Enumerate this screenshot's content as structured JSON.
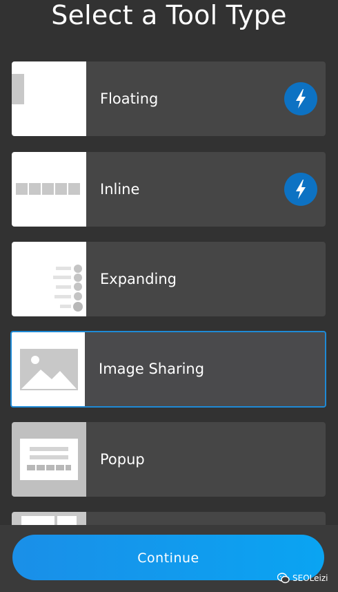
{
  "header": {
    "title": "Select a Tool Type"
  },
  "tools": [
    {
      "label": "Floating",
      "badge_icon": "lightning-bolt-icon",
      "thumbnail_icon": "floating-bar-icon"
    },
    {
      "label": "Inline",
      "badge_icon": "lightning-bolt-icon",
      "thumbnail_icon": "inline-bar-icon"
    },
    {
      "label": "Expanding",
      "thumbnail_icon": "expanding-menu-icon"
    },
    {
      "label": "Image Sharing",
      "selected": true,
      "thumbnail_icon": "image-placeholder-icon"
    },
    {
      "label": "Popup",
      "thumbnail_icon": "popup-window-icon"
    },
    {
      "label": "",
      "thumbnail_icon": "layout-grid-icon"
    }
  ],
  "footer": {
    "continue_label": "Continue"
  },
  "watermark": {
    "text": "SEOLeizi",
    "icon": "wechat-icon"
  },
  "colors": {
    "background": "#323232",
    "card": "#464646",
    "accent": "#1e8ad6",
    "badge": "#0d72c3",
    "continue_gradient": [
      "#1a8fe8",
      "#0aa4f2"
    ]
  }
}
